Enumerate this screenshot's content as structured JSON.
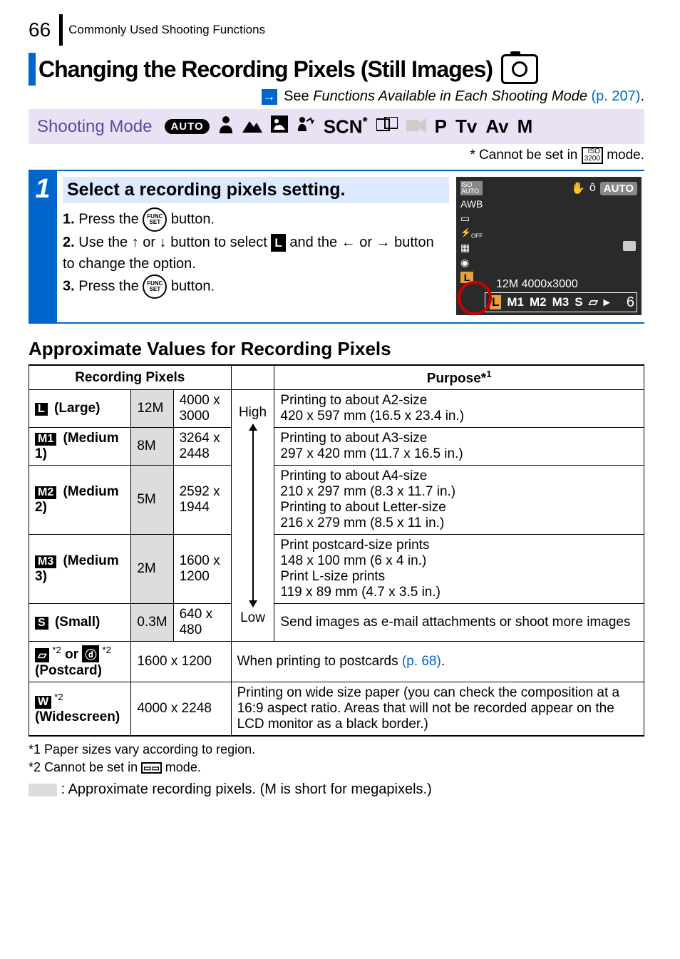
{
  "header": {
    "page_number": "66",
    "section": "Commonly Used Shooting Functions"
  },
  "title": "Changing the Recording Pixels (Still Images)",
  "see_ref": {
    "prefix": " See ",
    "text": "Functions Available in Each Shooting Mode",
    "page_ref": " (p. 207)",
    "period": "."
  },
  "mode": {
    "label": "Shooting Mode",
    "icons": {
      "auto": "AUTO",
      "scn": "SCN",
      "p": "P",
      "tv": "Tv",
      "av": "Av",
      "m": "M",
      "star": "*"
    },
    "footnote": "* Cannot be set in ",
    "footnote_suffix": " mode.",
    "iso_text": "ISO\n3200"
  },
  "step": {
    "num": "1",
    "title": "Select a recording pixels setting.",
    "items": [
      {
        "num": "1.",
        "prefix": "Press the ",
        "suffix": " button."
      },
      {
        "num": "2.",
        "t1": "Use the ",
        "t2": " or ",
        "t3": " button to select ",
        "t4": " and the ",
        "t5": " or ",
        "t6": " button to change the option."
      },
      {
        "num": "3.",
        "prefix": "Press the ",
        "suffix": " button."
      }
    ],
    "func_label": "FUNC\nSET",
    "l_badge": "L"
  },
  "screenshot": {
    "auto": "AUTO",
    "reso": "12M 4000x3000",
    "bar": {
      "L": "L",
      "M1": "M1",
      "M2": "M2",
      "M3": "M3",
      "S": "S"
    },
    "n": "6",
    "iso": "ISO\nAUTO",
    "awb": "AWB"
  },
  "approx_title": "Approximate Values for Recording Pixels",
  "table": {
    "headers": {
      "rp": "Recording Pixels",
      "purpose": "Purpose*",
      "purpose_sup": "1"
    },
    "labels": {
      "high": "High",
      "low": "Low"
    },
    "rows": [
      {
        "badge": "L",
        "name": " (Large)",
        "mp": "12M",
        "res": "4000 x 3000",
        "purpose": "Printing to about A2-size\n420 x 597 mm (16.5 x 23.4 in.)"
      },
      {
        "badge": "M1",
        "name": " (Medium 1)",
        "mp": "8M",
        "res": "3264 x 2448",
        "purpose": "Printing to about A3-size\n297 x 420 mm (11.7 x 16.5 in.)"
      },
      {
        "badge": "M2",
        "name": " (Medium 2)",
        "mp": "5M",
        "res": "2592 x 1944",
        "purpose": "Printing to about A4-size\n210 x 297 mm (8.3 x 11.7 in.)\nPrinting to about Letter-size\n216 x 279 mm (8.5 x 11 in.)"
      },
      {
        "badge": "M3",
        "name": " (Medium 3)",
        "mp": "2M",
        "res": "1600 x 1200",
        "purpose": "Print postcard-size prints\n148 x 100 mm (6 x 4 in.)\nPrint L-size prints\n119 x 89 mm (4.7 x 3.5 in.)"
      },
      {
        "badge": "S",
        "name": " (Small)",
        "mp": "0.3M",
        "res": "640 x 480",
        "purpose": "Send images as e-mail attachments or shoot more images"
      }
    ],
    "postcard": {
      "sup": "*2",
      "or": " or ",
      "name": "(Postcard)",
      "res": "1600 x 1200",
      "purpose_prefix": "When printing to postcards ",
      "purpose_link": "(p. 68)",
      "purpose_suffix": "."
    },
    "widescreen": {
      "badge": "W",
      "sup": "*2",
      "name": "(Widescreen)",
      "res": "4000 x 2248",
      "purpose": "Printing on wide size paper (you can check the composition at a 16:9 aspect ratio. Areas that will not be recorded appear on the LCD monitor as a black border.)"
    }
  },
  "footnotes": {
    "f1": "*1 Paper sizes vary according to region.",
    "f2_prefix": "*2 Cannot be set in ",
    "f2_suffix": " mode.",
    "f3": ": Approximate recording pixels. (M is short for megapixels.)"
  }
}
